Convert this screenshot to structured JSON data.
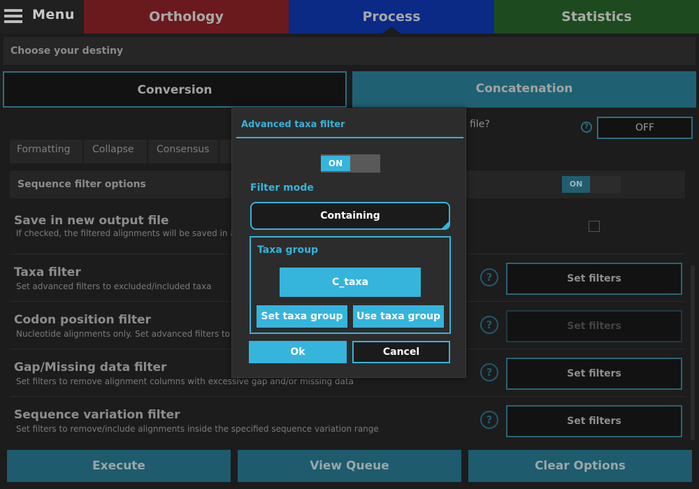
{
  "nav": {
    "menu_label": "Menu",
    "tabs": [
      {
        "label": "Orthology",
        "color": "#6a1a1d"
      },
      {
        "label": "Process",
        "color": "#0a2a86"
      },
      {
        "label": "Statistics",
        "color": "#1d4a1f"
      }
    ]
  },
  "destiny_header": "Choose your destiny",
  "modes": {
    "conversion": "Conversion",
    "concatenation": "Concatenation"
  },
  "single_file": {
    "question_fragment": "file?",
    "toggle_state": "OFF"
  },
  "subtabs": [
    "Formatting",
    "Collapse",
    "Consensus"
  ],
  "sequence_filter": {
    "label": "Sequence filter options",
    "toggle_state": "ON"
  },
  "filters": [
    {
      "title": "Save in new output file",
      "description": "If checked, the filtered alignments will be saved in a fil"
    },
    {
      "title": "Taxa filter",
      "description": "Set advanced filters to excluded/included taxa",
      "button": "Set filters"
    },
    {
      "title": "Codon position filter",
      "description": "Nucleotide alignments only. Set advanced filters to exc",
      "button": "Set filters"
    },
    {
      "title": "Gap/Missing data filter",
      "description": "Set filters to remove alignment columns with excessive gap and/or missing data",
      "button": "Set filters"
    },
    {
      "title": "Sequence variation filter",
      "description": "Set filters to remove/include alignments inside the specified sequence variation range",
      "button": "Set filters"
    }
  ],
  "bottom_actions": {
    "execute": "Execute",
    "view_queue": "View Queue",
    "clear_options": "Clear Options"
  },
  "help_glyph": "?",
  "dialog": {
    "title": "Advanced taxa filter",
    "toggle_state": "ON",
    "filter_mode_label": "Filter mode",
    "filter_mode_value": "Containing",
    "taxa_group_label": "Taxa group",
    "taxa_group_value": "C_taxa",
    "set_taxa_group": "Set taxa group",
    "use_taxa_group": "Use taxa group",
    "ok": "Ok",
    "cancel": "Cancel",
    "accent_color": "#35b5dc"
  }
}
